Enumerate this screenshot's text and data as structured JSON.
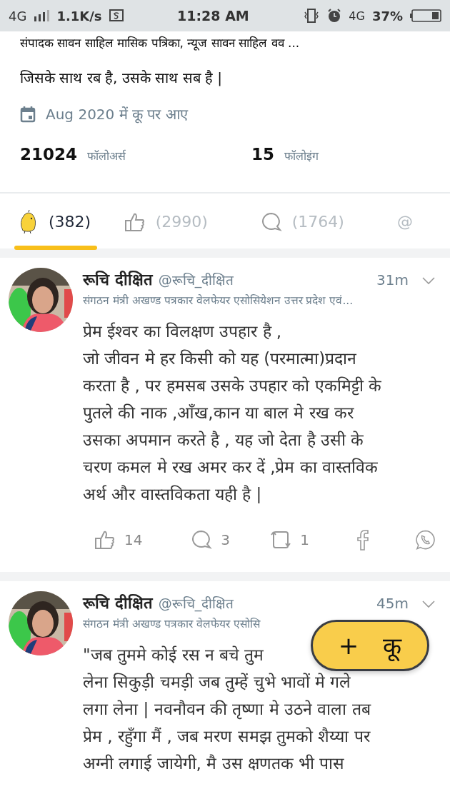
{
  "status_bar": {
    "network": "4G",
    "speed": "1.1K/s",
    "time": "11:28 AM",
    "data": "4G",
    "battery": "37%"
  },
  "profile": {
    "bio_cut": "संपादक सावन साहिल मासिक पत्रिका, न्यूज सावन साहिल वव ...",
    "motto": "जिसके साथ रब है, उसके साथ सब है |",
    "joined": "Aug 2020 में कू पर आए",
    "followers": {
      "count": "21024",
      "label": "फॉलोअर्स"
    },
    "following": {
      "count": "15",
      "label": "फॉलोइंग"
    }
  },
  "tabs": [
    {
      "kind": "koo",
      "label": "(382)",
      "selected": true
    },
    {
      "kind": "likes",
      "label": "(2990)",
      "selected": false
    },
    {
      "kind": "comments",
      "label": "(1764)",
      "selected": false
    },
    {
      "kind": "mentions",
      "label": "@",
      "selected": false
    }
  ],
  "posts": [
    {
      "name": "रूचि दीक्षित",
      "handle": "@रूचि_दीक्षित",
      "time": "31m",
      "subtitle": "संगठन मंत्री अखण्ड पत्रकार वेलफेयर एसोसियेशन उत्तर प्रदेश एवं...",
      "lines": [
        "प्रेम ईश्वर का विलक्षण उपहार है ,",
        "जो जीवन मे हर किसी को यह (परमात्मा)प्रदान",
        "करता है , पर हमसब उसके उपहार को एकमिट्टी के",
        "पुतले की नाक  ,आँख,कान  या बाल मे रख कर",
        "उसका अपमान करते है , यह जो देता है उसी के",
        "चरण कमल मे रख अमर कर दें ,प्रेम का वास्तविक",
        "अर्थ और वास्तविकता यही है |"
      ],
      "likes": "14",
      "comments": "3",
      "rekoos": "1"
    },
    {
      "name": "रूचि दीक्षित",
      "handle": "@रूचि_दीक्षित",
      "time": "45m",
      "subtitle": "संगठन मंत्री अखण्ड पत्रकार वेलफेयर एसोसि",
      "lines": [
        "\"जब तुममे कोई रस न बचे तुम",
        "लेना सिकुड़ी चमड़ी जब तुम्हें चुभे भावों मे गले",
        "लगा लेना | नवनौवन की तृष्णा मे उठने वाला तब",
        "प्रेम , रहुँगा मैं , जब मरण समझ तुमको शैय्या पर",
        "अग्नी लगाई जायेगी,  मै उस क्षणतक भी पास"
      ]
    }
  ],
  "fab": {
    "plus": "+",
    "label": "कू"
  }
}
